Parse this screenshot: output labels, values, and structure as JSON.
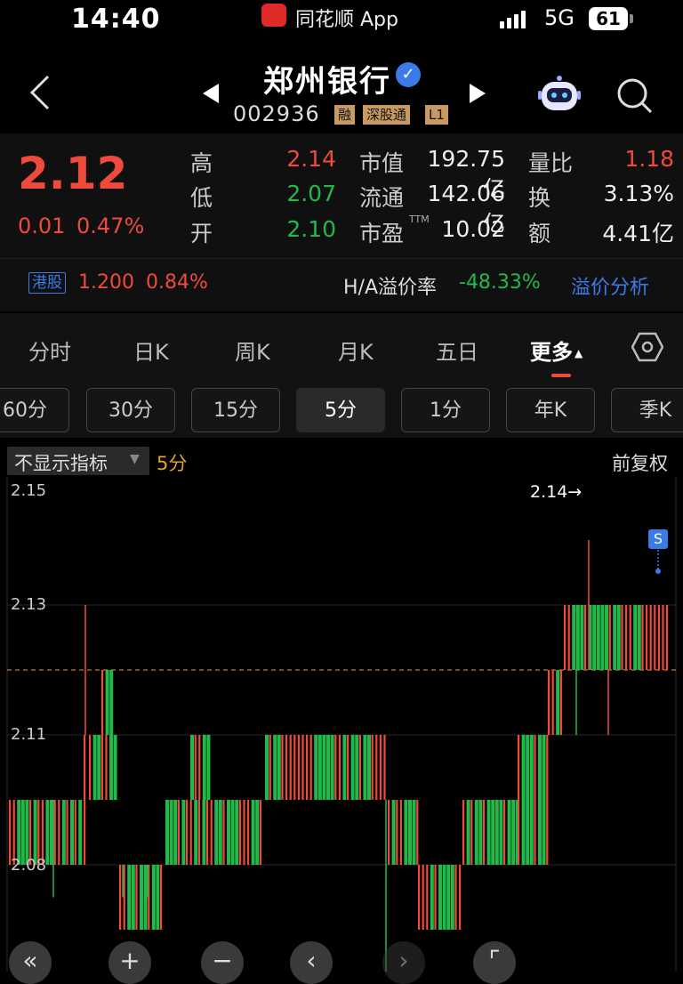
{
  "status_bar": {
    "time": "14:40",
    "app_name": "同花顺 App",
    "network": "5G",
    "battery": "61"
  },
  "header": {
    "stock_name": "郑州银行",
    "stock_code": "002936",
    "tags": [
      "融",
      "深股通",
      "L1"
    ]
  },
  "quote": {
    "price": "2.12",
    "change": "0.01",
    "change_pct": "0.47%",
    "rows": [
      {
        "l1": "高",
        "v1": "2.14",
        "l2": "市值",
        "v2": "192.75亿",
        "l3": "量比",
        "v3": "1.18"
      },
      {
        "l1": "低",
        "v1": "2.07",
        "l2": "流通",
        "v2": "142.06亿",
        "l3": "换",
        "v3": "3.13%"
      },
      {
        "l1": "开",
        "v1": "2.10",
        "l2": "市盈",
        "l2_sup": "TTM",
        "v2": "10.02",
        "l3": "额",
        "v3": "4.41亿"
      }
    ],
    "hk": {
      "tag": "港股",
      "price": "1.200",
      "pct": "0.84%",
      "premium_label": "H/A溢价率",
      "premium": "-48.33%",
      "link": "溢价分析"
    }
  },
  "tabs": {
    "main": [
      "分时",
      "日K",
      "周K",
      "月K",
      "五日",
      "更多"
    ],
    "periods": [
      "60分",
      "30分",
      "15分",
      "5分",
      "1分",
      "年K",
      "季K"
    ],
    "active_period": "5分"
  },
  "chart_header": {
    "indicator": "不显示指标",
    "period": "5分",
    "adjust": "前复权"
  },
  "chart_data": {
    "type": "candlestick",
    "y_ticks": [
      "2.15",
      "2.13",
      "2.11",
      "2.08"
    ],
    "high_marker": "2.14→",
    "signal_marker": "S",
    "ref_line": 2.12,
    "colors": {
      "up": "#f04a3c",
      "down": "#22b94b",
      "ref": "#c8783a"
    }
  },
  "colors": {
    "up": "#f04a3c",
    "down": "#22b94b",
    "link": "#3b7be8",
    "accent": "#e8a030"
  },
  "controls": [
    "«",
    "+",
    "−",
    "‹",
    "›",
    "⌜"
  ]
}
